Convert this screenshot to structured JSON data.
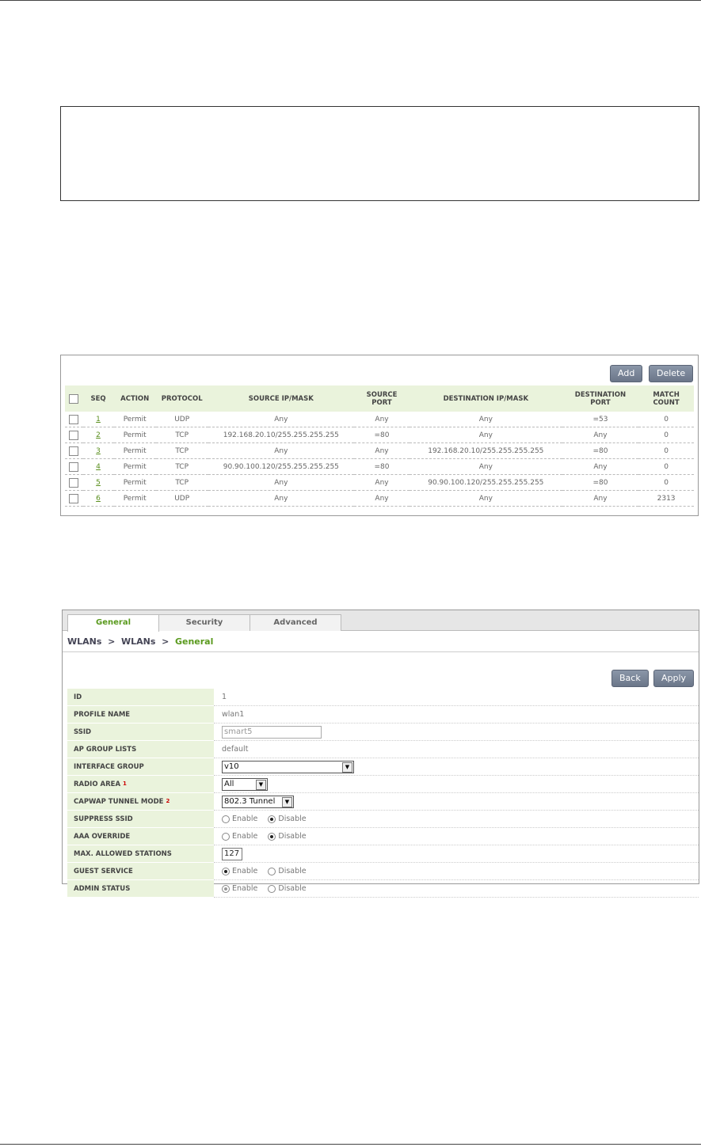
{
  "acl": {
    "add_label": "Add",
    "delete_label": "Delete",
    "headers": {
      "seq": "SEQ",
      "action": "ACTION",
      "protocol": "PROTOCOL",
      "source_ip": "SOURCE IP/MASK",
      "source_port_1": "SOURCE",
      "source_port_2": "PORT",
      "dest_ip": "DESTINATION IP/MASK",
      "dest_port_1": "DESTINATION",
      "dest_port_2": "PORT",
      "match_1": "MATCH",
      "match_2": "COUNT"
    },
    "rows": [
      {
        "seq": "1",
        "action": "Permit",
        "protocol": "UDP",
        "source_ip": "Any",
        "source_port": "Any",
        "dest_ip": "Any",
        "dest_port": "=53",
        "match": "0"
      },
      {
        "seq": "2",
        "action": "Permit",
        "protocol": "TCP",
        "source_ip": "192.168.20.10/255.255.255.255",
        "source_port": "=80",
        "dest_ip": "Any",
        "dest_port": "Any",
        "match": "0"
      },
      {
        "seq": "3",
        "action": "Permit",
        "protocol": "TCP",
        "source_ip": "Any",
        "source_port": "Any",
        "dest_ip": "192.168.20.10/255.255.255.255",
        "dest_port": "=80",
        "match": "0"
      },
      {
        "seq": "4",
        "action": "Permit",
        "protocol": "TCP",
        "source_ip": "90.90.100.120/255.255.255.255",
        "source_port": "=80",
        "dest_ip": "Any",
        "dest_port": "Any",
        "match": "0"
      },
      {
        "seq": "5",
        "action": "Permit",
        "protocol": "TCP",
        "source_ip": "Any",
        "source_port": "Any",
        "dest_ip": "90.90.100.120/255.255.255.255",
        "dest_port": "=80",
        "match": "0"
      },
      {
        "seq": "6",
        "action": "Permit",
        "protocol": "UDP",
        "source_ip": "Any",
        "source_port": "Any",
        "dest_ip": "Any",
        "dest_port": "Any",
        "match": "2313"
      }
    ]
  },
  "wlan": {
    "tabs": [
      "General",
      "Security",
      "Advanced"
    ],
    "breadcrumb": {
      "first": "WLANs",
      "sep": ">",
      "second": "WLANs",
      "current": "General"
    },
    "back_label": "Back",
    "apply_label": "Apply",
    "fields": {
      "id": {
        "label": "ID",
        "value": "1"
      },
      "profile_name": {
        "label": "PROFILE NAME",
        "value": "wlan1"
      },
      "ssid": {
        "label": "SSID",
        "value": "smart5"
      },
      "ap_group_lists": {
        "label": "AP GROUP LISTS",
        "value": "default"
      },
      "interface_group": {
        "label": "INTERFACE GROUP",
        "value": "v10"
      },
      "radio_area": {
        "label": "RADIO AREA",
        "note": "1",
        "value": "All"
      },
      "capwap_tunnel_mode": {
        "label": "CAPWAP TUNNEL MODE",
        "note": "2",
        "value": "802.3 Tunnel"
      },
      "suppress_ssid": {
        "label": "SUPPRESS SSID",
        "selected": "Disable"
      },
      "aaa_override": {
        "label": "AAA OVERRIDE",
        "selected": "Disable"
      },
      "max_allowed_stations": {
        "label": "MAX. ALLOWED STATIONS",
        "value": "127"
      },
      "guest_service": {
        "label": "GUEST SERVICE",
        "selected": "Enable"
      },
      "admin_status": {
        "label": "ADMIN STATUS",
        "selected": "Enable"
      }
    },
    "enable_label": "Enable",
    "disable_label": "Disable"
  }
}
